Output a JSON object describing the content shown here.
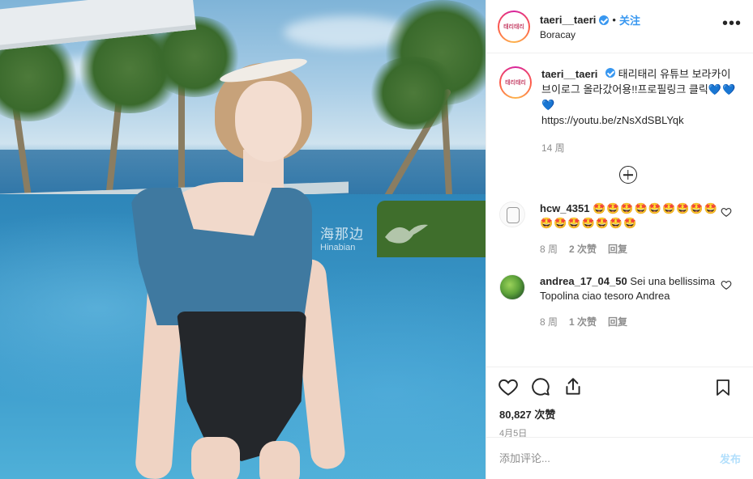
{
  "photo": {
    "watermark_text": "海那边",
    "watermark_sub": "Hinabian"
  },
  "header": {
    "avatar_text": "태리태리",
    "username": "taeri__taeri",
    "separator": "•",
    "follow_label": "关注",
    "location": "Boracay",
    "more_label": "•••"
  },
  "caption": {
    "avatar_text": "태리태리",
    "username": "taeri__taeri",
    "text": "태리태리 유튜브 보라카이 브이로그 올라갔어용!!프로필링크 클릭",
    "hearts": "💙💙💙",
    "link": "https://youtu.be/zNsXdSBLYqk",
    "time": "14 周"
  },
  "comments": [
    {
      "username": "hcw_4351",
      "text": "🤩🤩🤩🤩🤩🤩🤩🤩🤩🤩🤩🤩🤩🤩🤩🤩",
      "time": "8 周",
      "likes": "2 次赞",
      "reply": "回复"
    },
    {
      "username": "andrea_17_04_50",
      "text": "Sei una bellissima Topolina ciao tesoro Andrea",
      "time": "8 周",
      "likes": "1 次赞",
      "reply": "回复"
    }
  ],
  "stats": {
    "likes": "80,827 次赞",
    "date": "4月5日"
  },
  "add_comment": {
    "placeholder": "添加评论...",
    "post_label": "发布"
  },
  "colors": {
    "accent": "#3897f0",
    "muted": "#8e8e8e",
    "post_disabled": "#b2dffc"
  }
}
